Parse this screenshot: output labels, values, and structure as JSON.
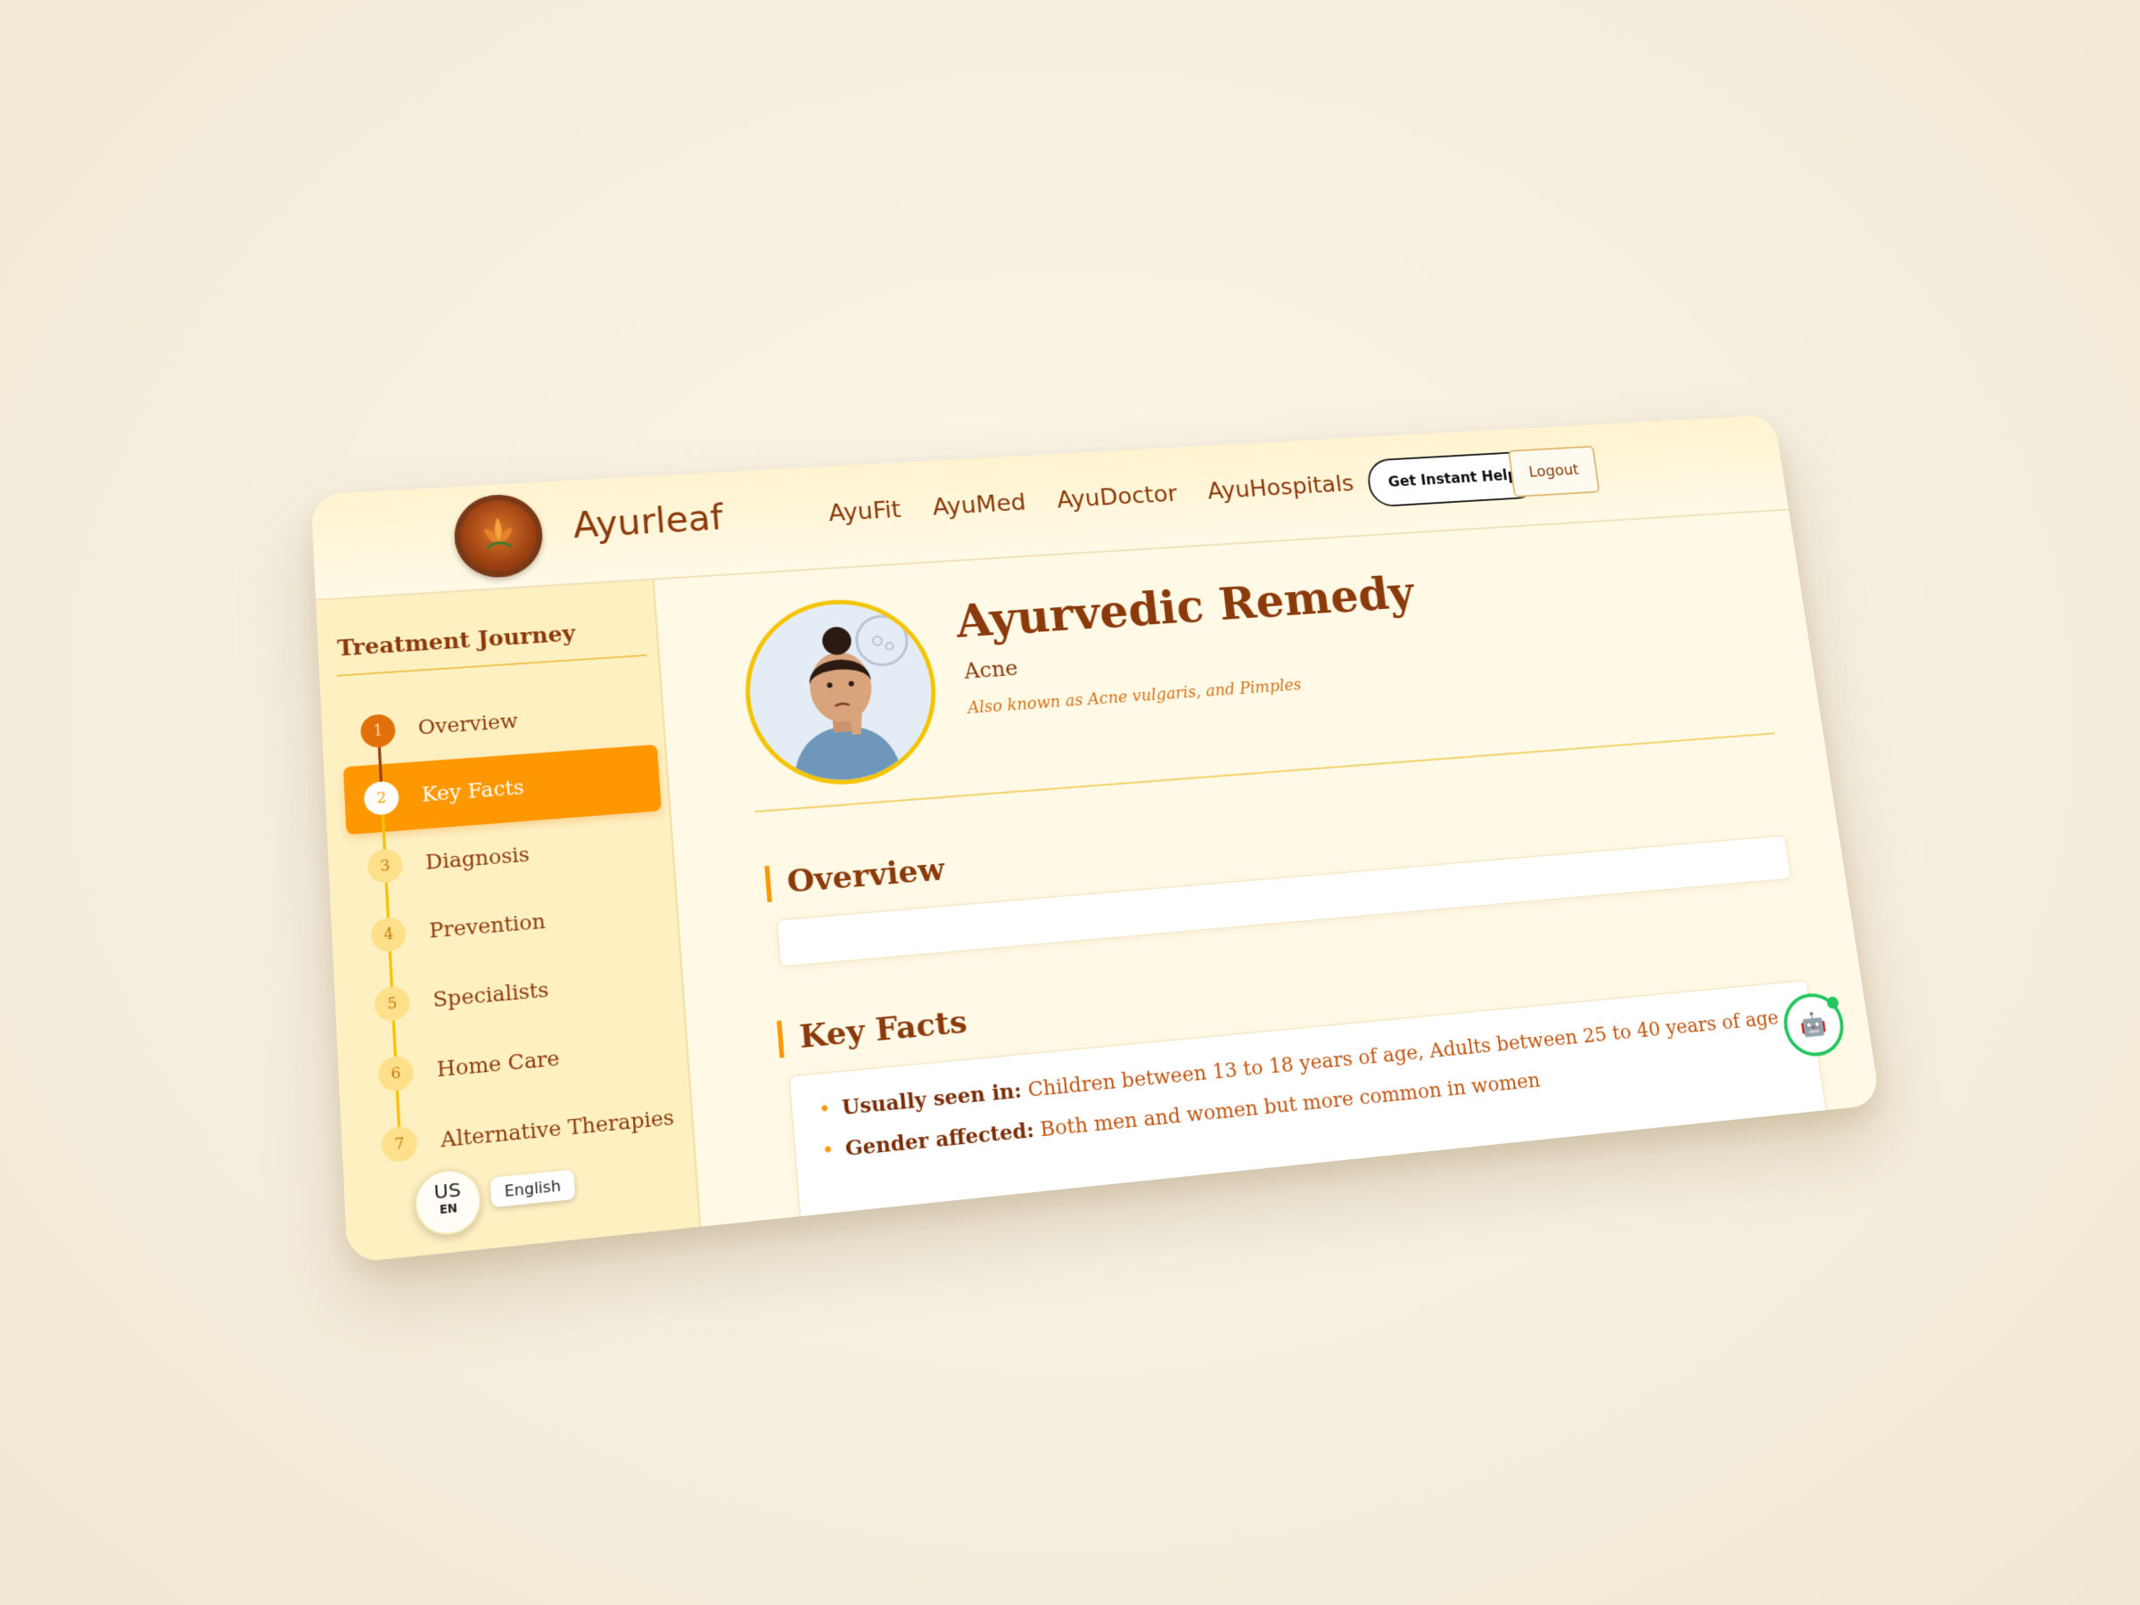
{
  "header": {
    "brand": "Ayurleaf",
    "nav": [
      "AyuFit",
      "AyuMed",
      "AyuDoctor",
      "AyuHospitals"
    ],
    "help_button": "Get Instant Help",
    "logout_button": "Logout"
  },
  "sidebar": {
    "title": "Treatment Journey",
    "steps": [
      {
        "num": "1",
        "label": "Overview"
      },
      {
        "num": "2",
        "label": "Key Facts"
      },
      {
        "num": "3",
        "label": "Diagnosis"
      },
      {
        "num": "4",
        "label": "Prevention"
      },
      {
        "num": "5",
        "label": "Specialists"
      },
      {
        "num": "6",
        "label": "Home Care"
      },
      {
        "num": "7",
        "label": "Alternative Therapies"
      }
    ],
    "language": {
      "country": "US",
      "code": "EN",
      "name": "English"
    }
  },
  "main": {
    "title": "Ayurvedic Remedy",
    "condition": "Acne",
    "aka": "Also known as Acne vulgaris, and Pimples",
    "overview_heading": "Overview",
    "keyfacts_heading": "Key Facts",
    "facts": [
      {
        "label": "Usually seen in:",
        "text": " Children between 13 to 18 years of age, Adults between 25 to 40 years of age"
      },
      {
        "label": "Gender affected:",
        "text": " Both men and women but more common in women"
      }
    ]
  },
  "colors": {
    "accent": "#ff9800",
    "brand": "#8b3a0b",
    "chat": "#22c55e"
  }
}
